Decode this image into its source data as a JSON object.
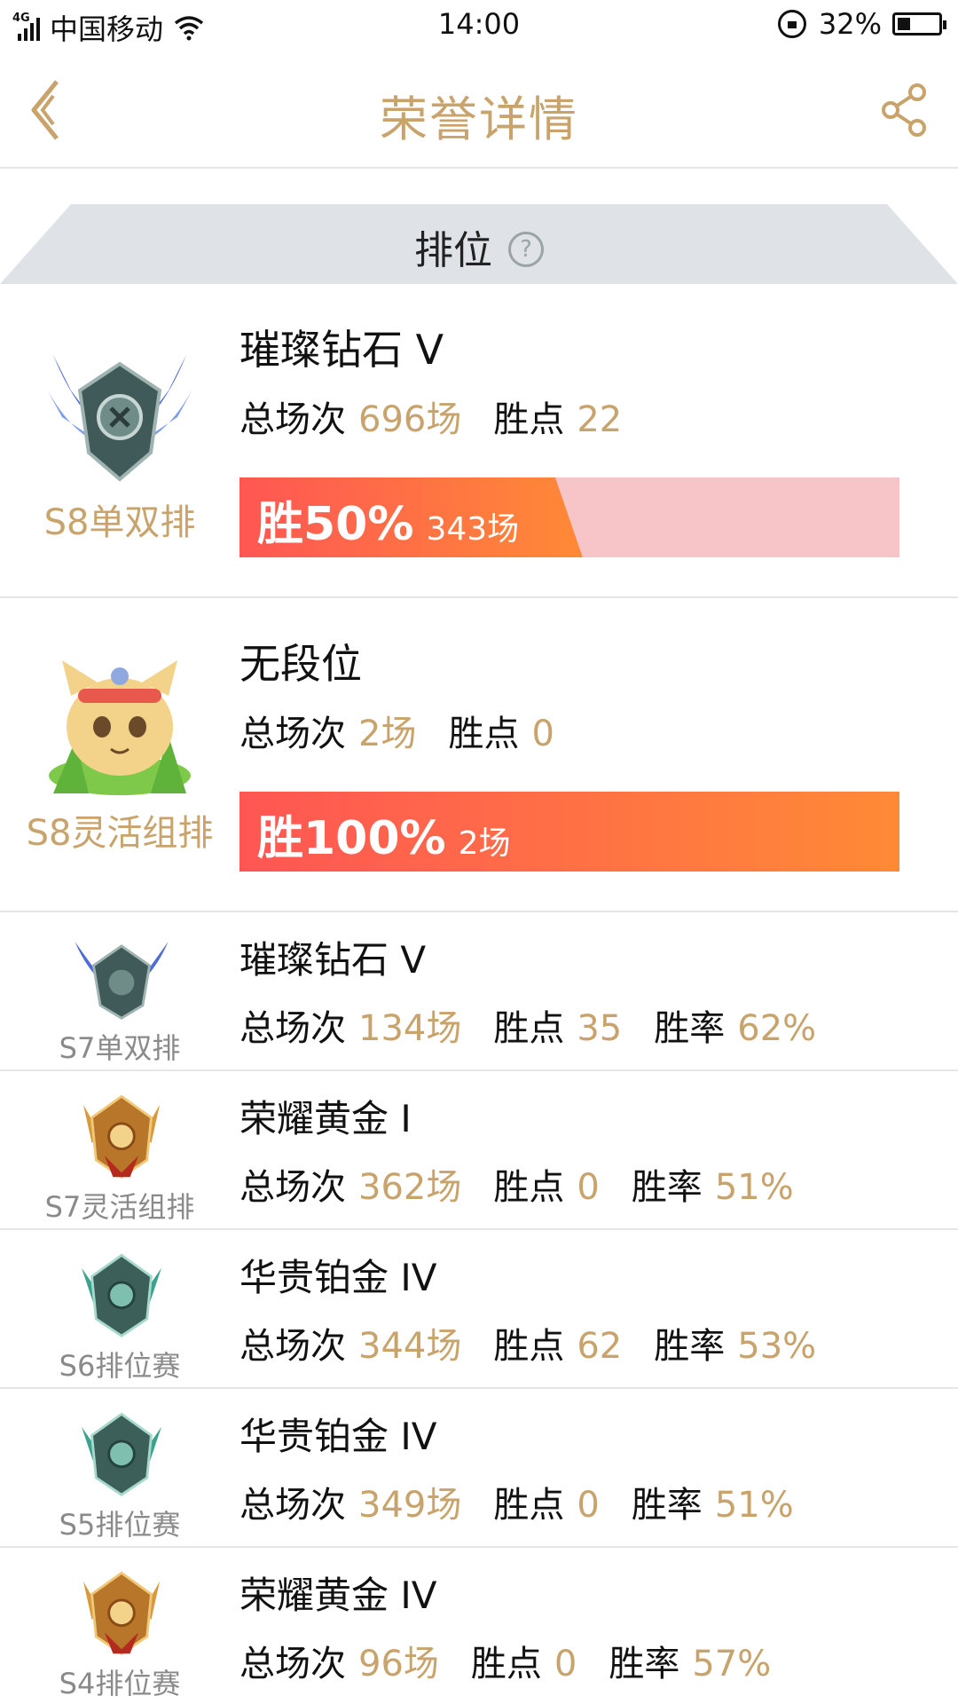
{
  "status_bar": {
    "network": "4G",
    "carrier": "中国移动",
    "time": "14:00",
    "battery": "32%",
    "battery_level": 0.32
  },
  "nav": {
    "title": "荣誉详情",
    "back_icon": "chevron-left-icon",
    "share_icon": "share-icon"
  },
  "section": {
    "title": "排位",
    "help_symbol": "?"
  },
  "featured": [
    {
      "season": "S8单双排",
      "tier": "璀璨钻石 V",
      "total_label": "总场次",
      "total": "696场",
      "points_label": "胜点",
      "points": "22",
      "win_label": "胜50%",
      "win_count": "343场",
      "win_fraction": 0.5,
      "badge": "diamond-badge-icon"
    },
    {
      "season": "S8灵活组排",
      "tier": "无段位",
      "total_label": "总场次",
      "total": "2场",
      "points_label": "胜点",
      "points": "0",
      "win_label": "胜100%",
      "win_count": "2场",
      "win_fraction": 1.0,
      "badge": "teemo-unranked-icon"
    }
  ],
  "history": [
    {
      "season": "S7单双排",
      "tier": "璀璨钻石 V",
      "total": "134场",
      "points": "35",
      "rate": "62%",
      "badge": "diamond-badge-icon"
    },
    {
      "season": "S7灵活组排",
      "tier": "荣耀黄金 I",
      "total": "362场",
      "points": "0",
      "rate": "51%",
      "badge": "gold-badge-icon"
    },
    {
      "season": "S6排位赛",
      "tier": "华贵铂金 IV",
      "total": "344场",
      "points": "62",
      "rate": "53%",
      "badge": "platinum-badge-icon"
    },
    {
      "season": "S5排位赛",
      "tier": "华贵铂金 IV",
      "total": "349场",
      "points": "0",
      "rate": "51%",
      "badge": "platinum-badge-icon"
    },
    {
      "season": "S4排位赛",
      "tier": "荣耀黄金 IV",
      "total": "96场",
      "points": "0",
      "rate": "57%",
      "badge": "gold-badge-icon"
    }
  ],
  "labels": {
    "total": "总场次",
    "points": "胜点",
    "rate": "胜率"
  },
  "colors": {
    "accent_gold": "#c8a36b",
    "bar_start": "#ff5654",
    "bar_end": "#ff8a36",
    "bar_bg": "#f7c4c8",
    "section_bg": "#dfe3e7"
  }
}
